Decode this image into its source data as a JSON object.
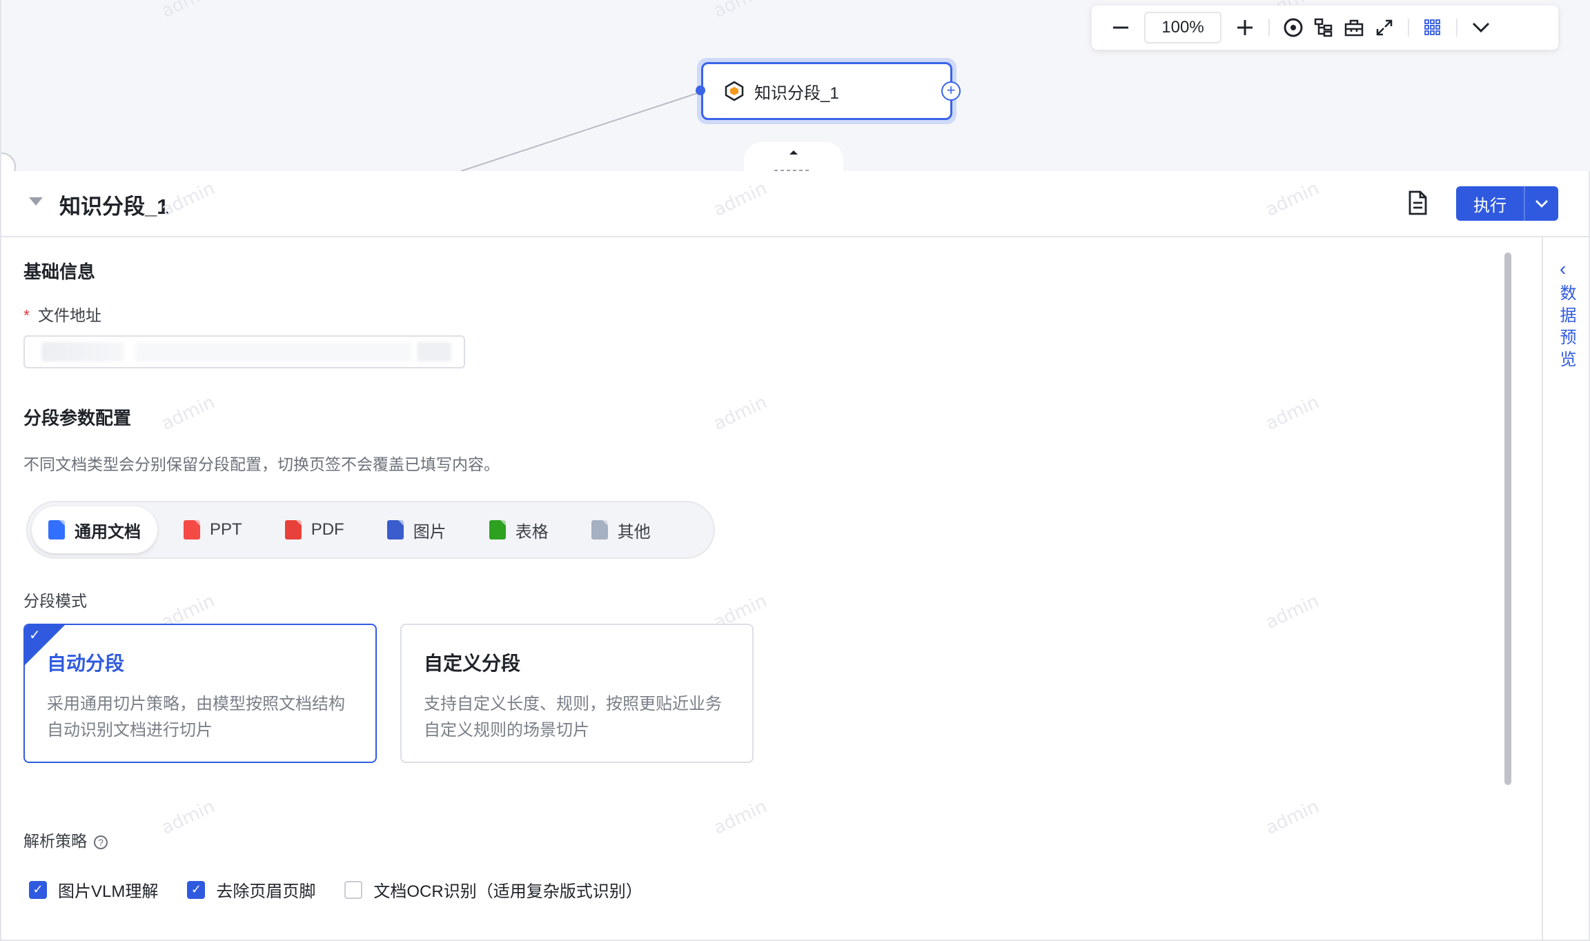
{
  "canvas": {
    "node_title": "知识分段_1",
    "watermark": "admin",
    "zoom_level": "100%"
  },
  "panel": {
    "title": "知识分段_1",
    "run_label": "执行",
    "sections": {
      "basic_info": "基础信息",
      "file_address_label": "文件地址",
      "segment_params": "分段参数配置",
      "segment_desc": "不同文档类型会分别保留分段配置，切换页签不会覆盖已填写内容。",
      "segment_mode_label": "分段模式",
      "parse_strategy_label": "解析策略"
    },
    "doc_tabs": [
      {
        "label": "通用文档",
        "color": "#3370ff",
        "active": true
      },
      {
        "label": "PPT",
        "color": "#f54a45",
        "active": false
      },
      {
        "label": "PDF",
        "color": "#e8403a",
        "active": false
      },
      {
        "label": "图片",
        "color": "#3a5ccc",
        "active": false
      },
      {
        "label": "表格",
        "color": "#2ea121",
        "active": false
      },
      {
        "label": "其他",
        "color": "#a5b0c2",
        "active": false
      }
    ],
    "modes": [
      {
        "title": "自动分段",
        "desc": "采用通用切片策略，由模型按照文档结构自动识别文档进行切片",
        "selected": true
      },
      {
        "title": "自定义分段",
        "desc": "支持自定义长度、规则，按照更贴近业务自定义规则的场景切片",
        "selected": false
      }
    ],
    "parse_options": [
      {
        "label": "图片VLM理解",
        "checked": true
      },
      {
        "label": "去除页眉页脚",
        "checked": true
      },
      {
        "label": "文档OCR识别（适用复杂版式识别）",
        "checked": false
      }
    ],
    "side_preview_label": "数据预览"
  },
  "colors": {
    "accent": "#2f5ae0",
    "required": "#e4393c"
  }
}
